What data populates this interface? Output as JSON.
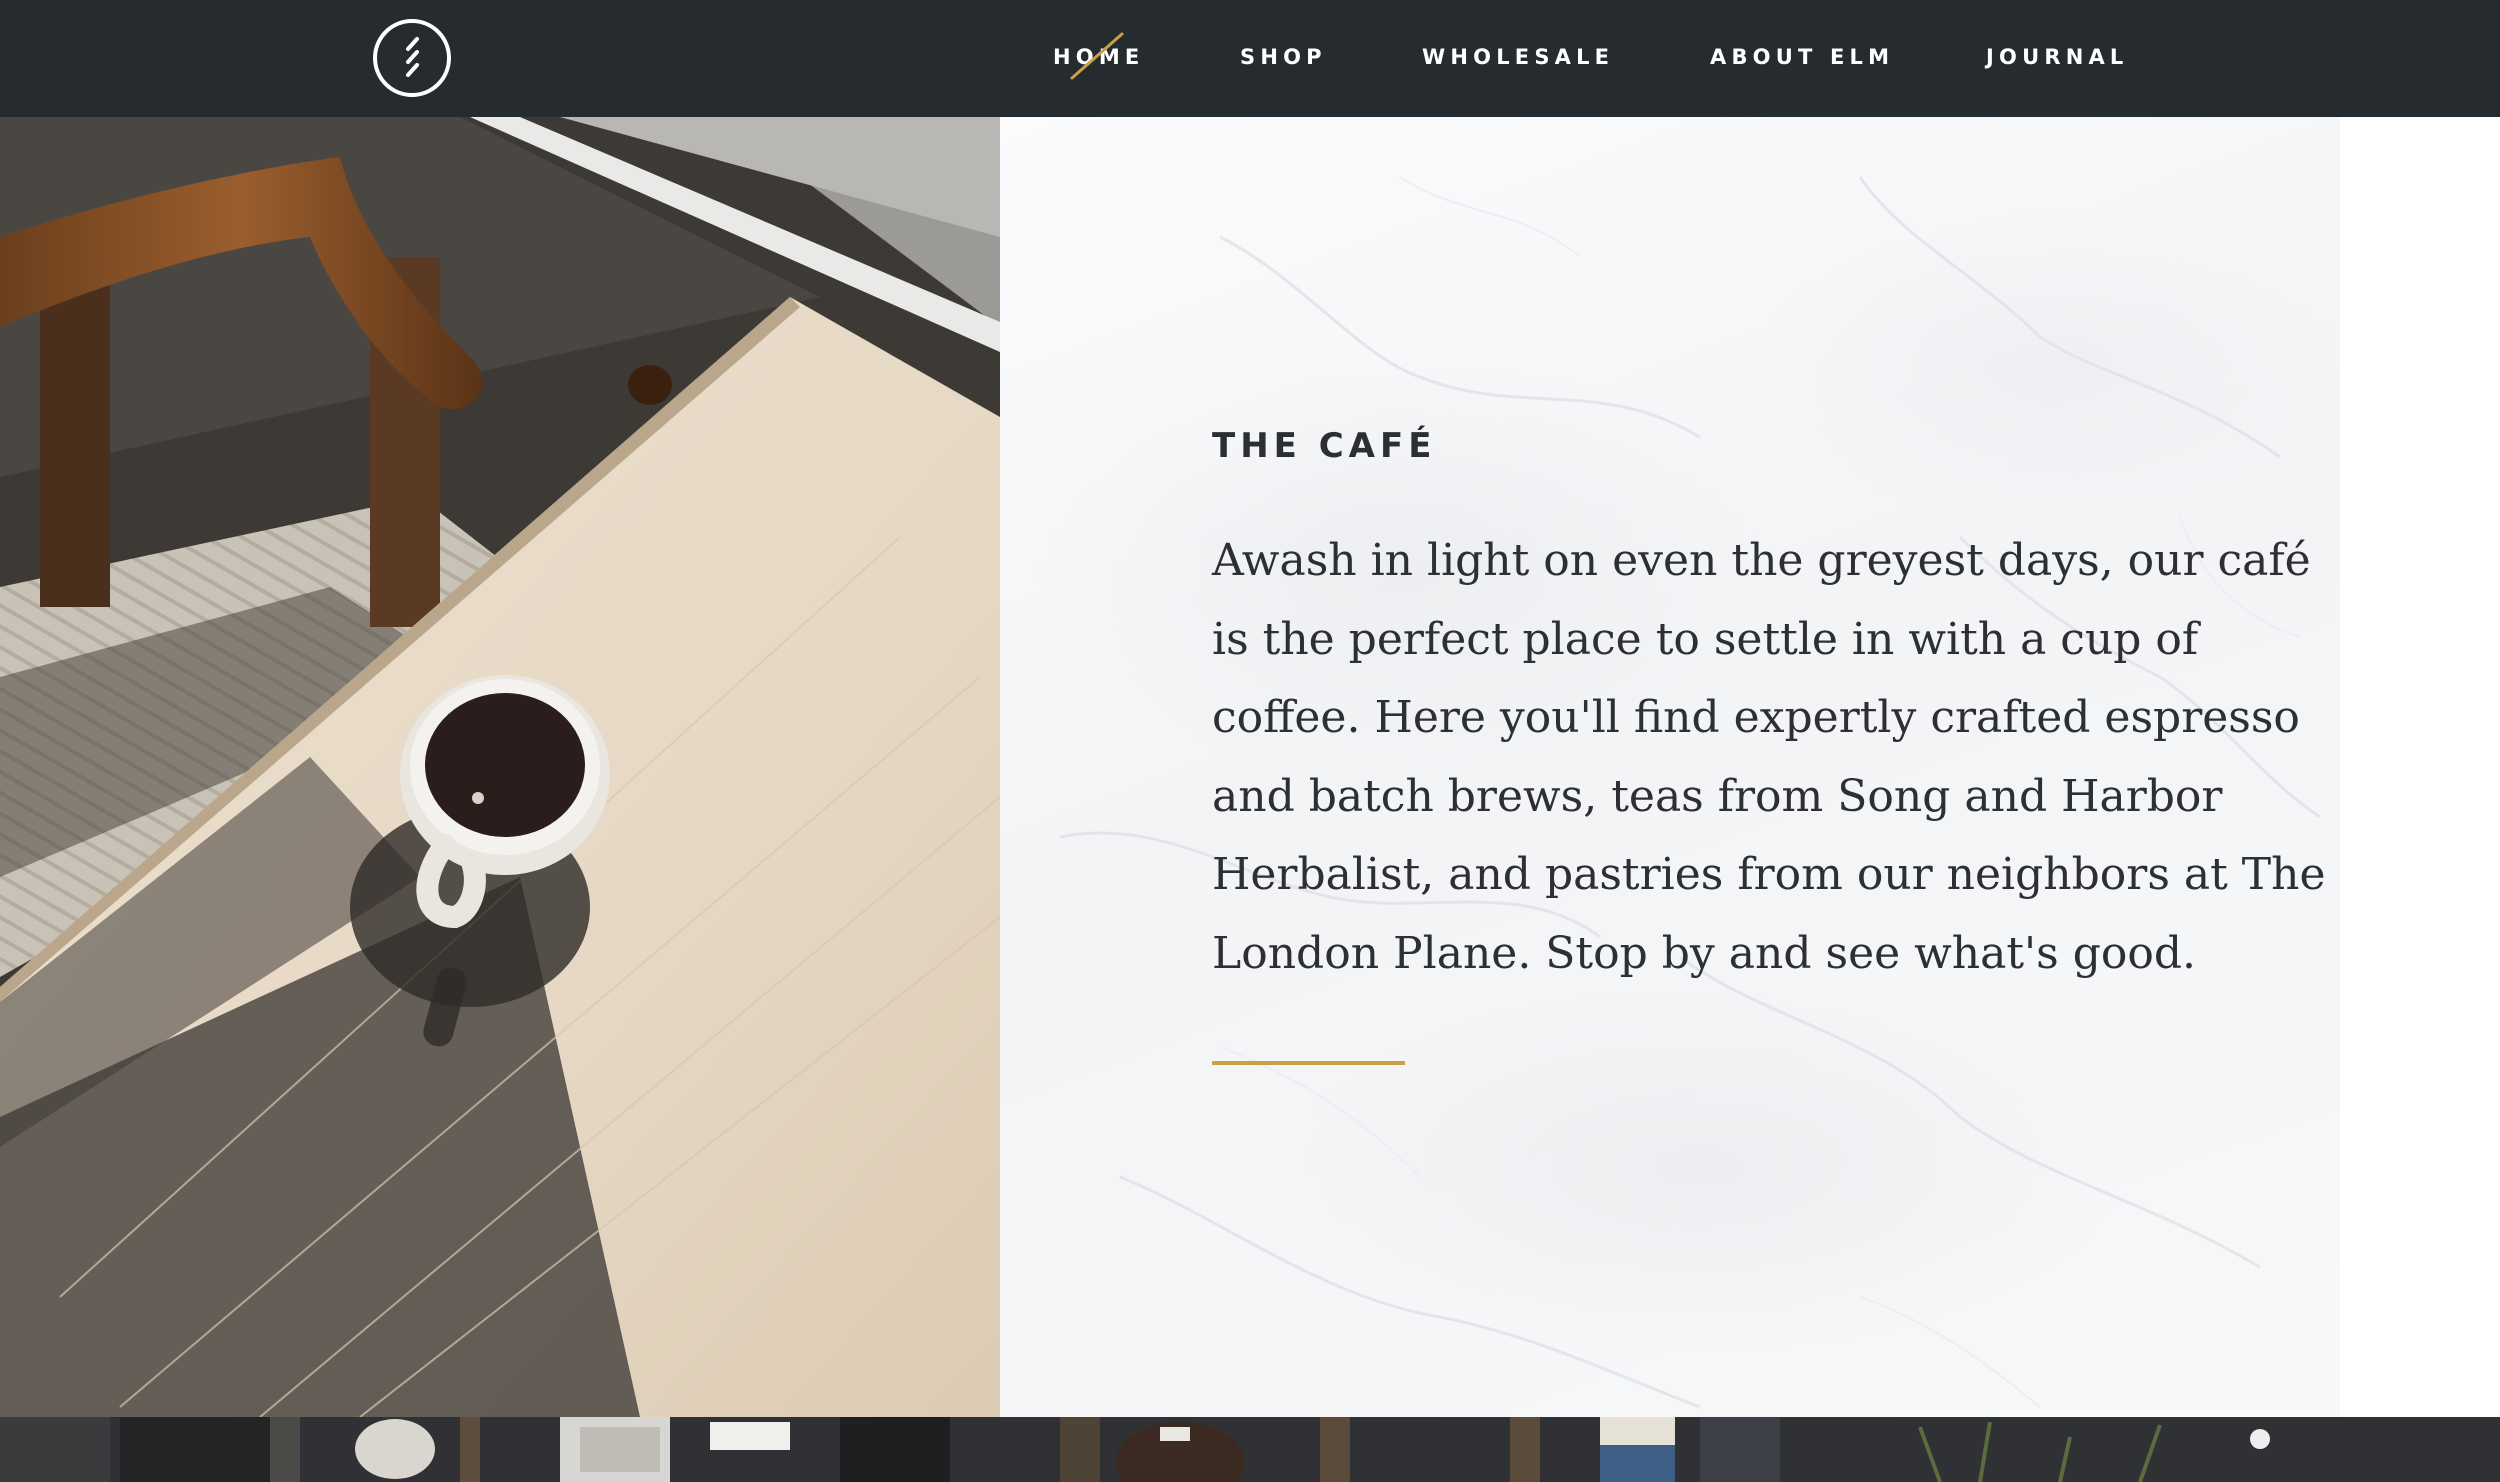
{
  "nav": {
    "items": [
      {
        "label": "HOME",
        "active": true
      },
      {
        "label": "SHOP"
      },
      {
        "label": "WHOLESALE"
      },
      {
        "label": "ABOUT ELM"
      },
      {
        "label": "JOURNAL"
      }
    ],
    "active_indicator_color": "#c9a14a"
  },
  "header": {
    "background": "#262b2f",
    "logo_icon": "elm-circle-logo-icon"
  },
  "hero": {
    "image": "coffee-cup-on-table-photo"
  },
  "cafe": {
    "title": "THE CAFÉ",
    "body": "Awash in light on even the greyest days, our café is the perfect place to settle in with a cup of coffee. Here you'll find expertly crafted espresso and batch brews, teas from Song and Harbor Herbalist, and pastries from our neighbors at The London Plane. Stop by and see what's good.",
    "accent_color": "#c9a14a"
  },
  "footer_strip": {
    "image": "cafe-shelf-photo"
  }
}
